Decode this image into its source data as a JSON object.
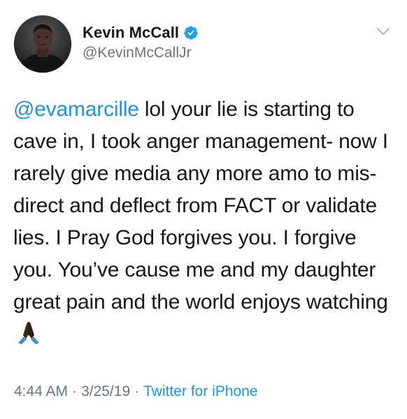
{
  "user": {
    "display_name": "Kevin McCall",
    "handle": "@KevinMcCallJr",
    "verified": true,
    "avatar_icon": "profile-photo"
  },
  "tweet": {
    "mention": "@evamarcille",
    "text_after_mention": " lol your lie is starting to cave in, I took anger management- now I rarely give media any more amo to mis-direct and deflect from FACT or validate lies. I Pray God forgives you. I forgive you. You’ve cause me and my daughter great pain and the world enjoys watching",
    "emoji": "🙏🏿",
    "emoji_icon": "folded-hands-icon"
  },
  "meta": {
    "time": "4:44 AM",
    "separator": "·",
    "date": "3/25/19",
    "source": "Twitter for iPhone"
  },
  "colors": {
    "accent": "#1b95e0",
    "text": "#14171a",
    "secondary": "#657786"
  },
  "icons": {
    "menu": "chevron-down-icon",
    "verified": "verified-badge-icon"
  }
}
